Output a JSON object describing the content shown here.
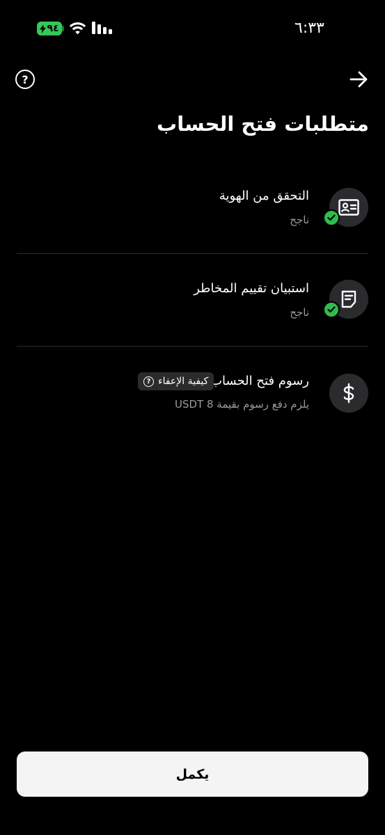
{
  "status_bar": {
    "time": "٦:٣٣",
    "battery": "٩٤"
  },
  "header": {
    "title": "متطلبات فتح الحساب"
  },
  "requirements": [
    {
      "title": "التحقق من الهوية",
      "status": "ناجح",
      "icon": "id-card-icon",
      "completed": true
    },
    {
      "title": "استبيان تقييم المخاطر",
      "status": "ناجح",
      "icon": "document-icon",
      "completed": true
    },
    {
      "title": "رسوم فتح الحساب",
      "status": "يلزم دفع رسوم بقيمة 8 USDT",
      "icon": "dollar-icon",
      "completed": false,
      "chip_label": "كيفية الإعفاء"
    }
  ],
  "footer": {
    "continue_label": "يكمل"
  },
  "colors": {
    "background": "#000000",
    "success": "#2dbe4f",
    "battery": "#34c759",
    "button_bg": "#f4f4f4"
  }
}
